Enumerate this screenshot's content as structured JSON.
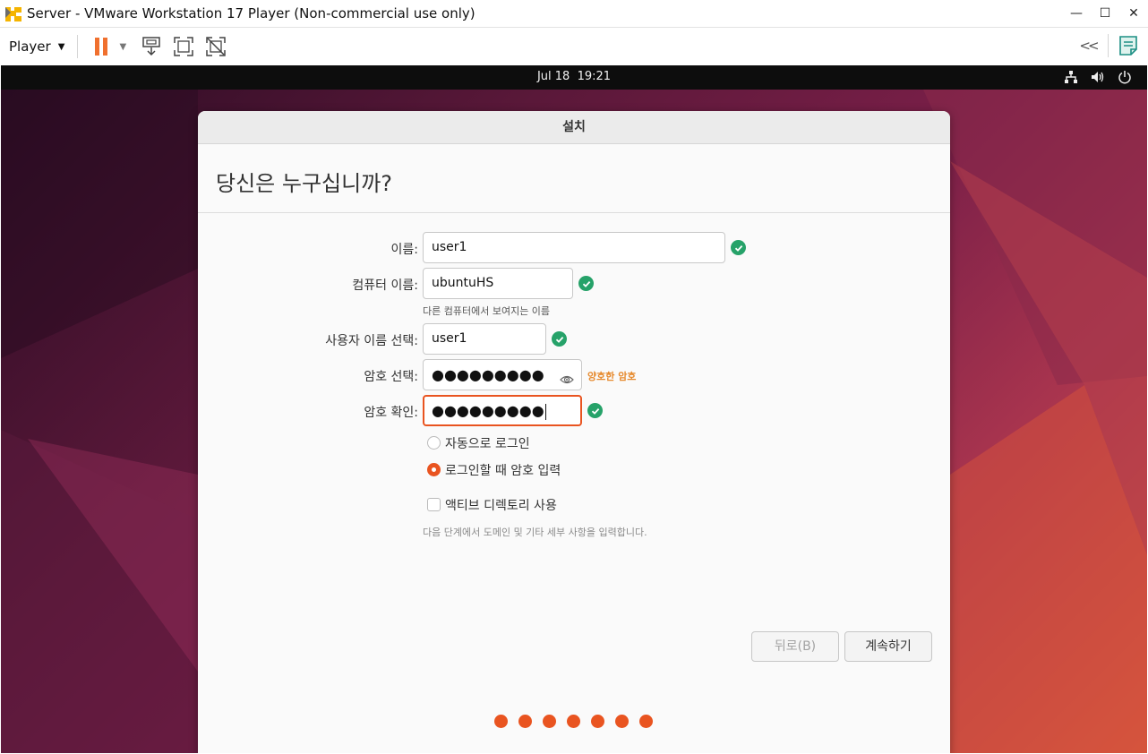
{
  "window": {
    "title": "Server - VMware Workstation 17 Player (Non-commercial use only)"
  },
  "toolbar": {
    "player_label": "Player",
    "icons": [
      "pause-icon",
      "dropdown-arrow-icon",
      "send-ctrl-alt-del-icon",
      "full-screen-icon",
      "unity-icon",
      "collapse-toolbar-icon",
      "notes-icon"
    ]
  },
  "guest_topbar": {
    "clock": "Jul 18  19:21",
    "tray_icons": [
      "network-icon",
      "volume-icon",
      "power-icon"
    ]
  },
  "installer": {
    "window_title": "설치",
    "heading": "당신은 누구십니까?",
    "fields": {
      "name": {
        "label": "이름:",
        "value": "user1"
      },
      "computer_name": {
        "label": "컴퓨터 이름:",
        "value": "ubuntuHS",
        "hint": "다른 컴퓨터에서 보여지는 이름"
      },
      "username": {
        "label": "사용자 이름 선택:",
        "value": "user1"
      },
      "password": {
        "label": "암호 선택:",
        "masked_value": "●●●●●●●●●",
        "strength": "양호한 암호"
      },
      "confirm_password": {
        "label": "암호 확인:",
        "masked_value": "●●●●●●●●●"
      }
    },
    "login_options": {
      "auto_login": {
        "label": "자동으로 로그인",
        "selected": false
      },
      "require_password": {
        "label": "로그인할 때 암호 입력",
        "selected": true
      }
    },
    "active_directory": {
      "label": "액티브 디렉토리 사용",
      "checked": false,
      "note": "다음 단계에서 도메인 및 기타 세부 사항을 입력합니다."
    },
    "buttons": {
      "back": "뒤로(B)",
      "continue": "계속하기"
    },
    "progress_steps": 7
  },
  "colors": {
    "accent": "#e95420",
    "valid": "#26a269",
    "strength_text": "#e6892c",
    "vmware_pause": "#f0702e"
  }
}
